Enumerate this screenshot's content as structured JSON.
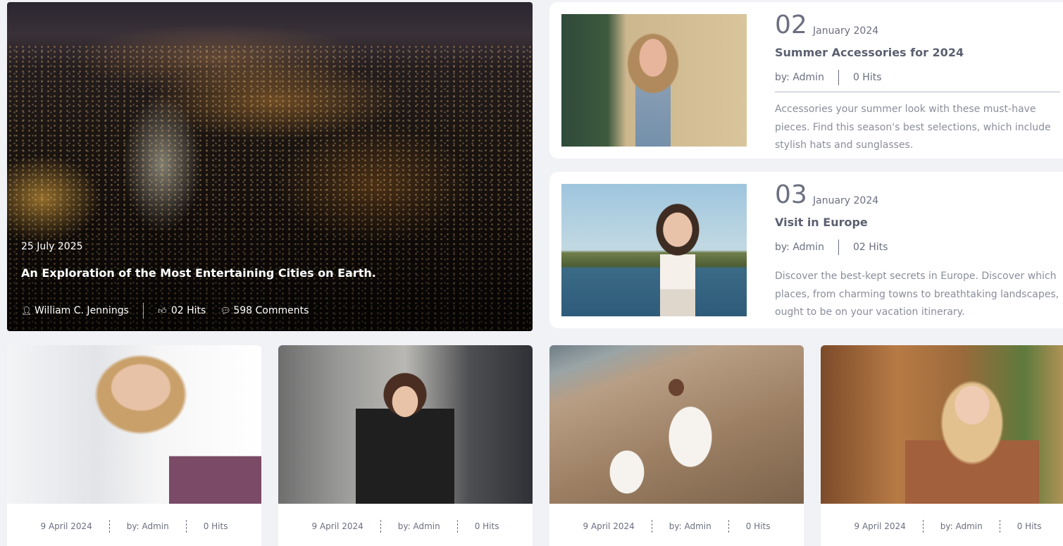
{
  "featured": {
    "date": "25 July 2025",
    "title": "An Exploration of the Most Entertaining Cities on Earth.",
    "author": "William C. Jennings",
    "hits": "02 Hits",
    "comments": "598 Comments",
    "author_icon": "user-icon",
    "hits_icon": "thumbs-up-icon",
    "comments_icon": "comments-icon"
  },
  "side_posts": [
    {
      "number": "02",
      "month": "January 2024",
      "title": "Summer Accessories for 2024",
      "author": "by: Admin",
      "hits": "0 Hits",
      "description": "Accessories your summer look with these must-have pieces. Find this season's best selections, which include stylish hats and sunglasses."
    },
    {
      "number": "03",
      "month": "January 2024",
      "title": "Visit in Europe",
      "author": "by: Admin",
      "hits": "02 Hits",
      "description": "Discover the best-kept secrets in Europe. Discover which places, from charming towns to breathtaking landscapes, ought to be on your vacation itinerary."
    }
  ],
  "grid_posts": [
    {
      "date": "9 April 2024",
      "author": "by: Admin",
      "hits": "0 Hits"
    },
    {
      "date": "9 April 2024",
      "author": "by: Admin",
      "hits": "0 Hits"
    },
    {
      "date": "9 April 2024",
      "author": "by: Admin",
      "hits": "0 Hits"
    },
    {
      "date": "9 April 2024",
      "author": "by: Admin",
      "hits": "0 Hits"
    }
  ]
}
